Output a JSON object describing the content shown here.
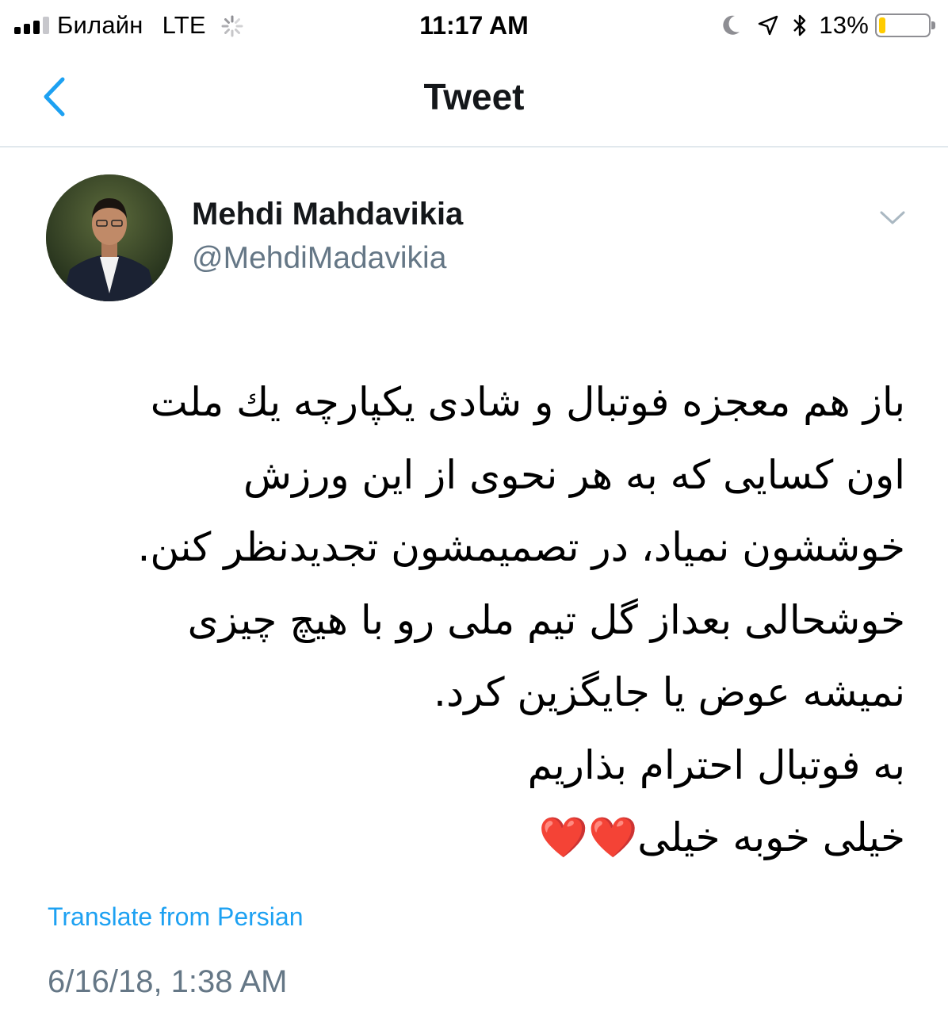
{
  "status_bar": {
    "carrier": "Билайн",
    "network": "LTE",
    "time": "11:17 AM",
    "battery_percent": "13%",
    "battery_level": 0.13,
    "icons": [
      "signal-icon",
      "activity-spinner-icon",
      "moon-icon",
      "location-arrow-icon",
      "bluetooth-icon",
      "battery-icon"
    ]
  },
  "nav": {
    "title": "Tweet",
    "back_icon": "back-chevron-icon"
  },
  "tweet": {
    "author_name": "Mehdi Mahdavikia",
    "author_handle": "@MehdiMadavikia",
    "options_icon": "chevron-down-icon",
    "lines": [
      "باز هم معجزه فوتبال و شادی یکپارچه یك ملت",
      "اون کسایی که به هر نحوی از این ورزش",
      "خوششون نمیاد، در تصمیمشون تجدیدنظر کنن.",
      "خوشحالی بعداز گل تیم ملی رو با  هیچ چیزی",
      "نمیشه عوض یا جایگزین کرد.",
      "به فوتبال احترام بذاریم",
      "خیلی خوبه خیلی"
    ],
    "hearts": "❤️❤️",
    "translate_label": "Translate from Persian",
    "timestamp": "6/16/18, 1:38 AM"
  },
  "colors": {
    "accent": "#1da1f2",
    "secondary_text": "#657786",
    "divider": "#e1e8ed",
    "battery_low": "#ffcc00",
    "heart": "#e0202a"
  }
}
